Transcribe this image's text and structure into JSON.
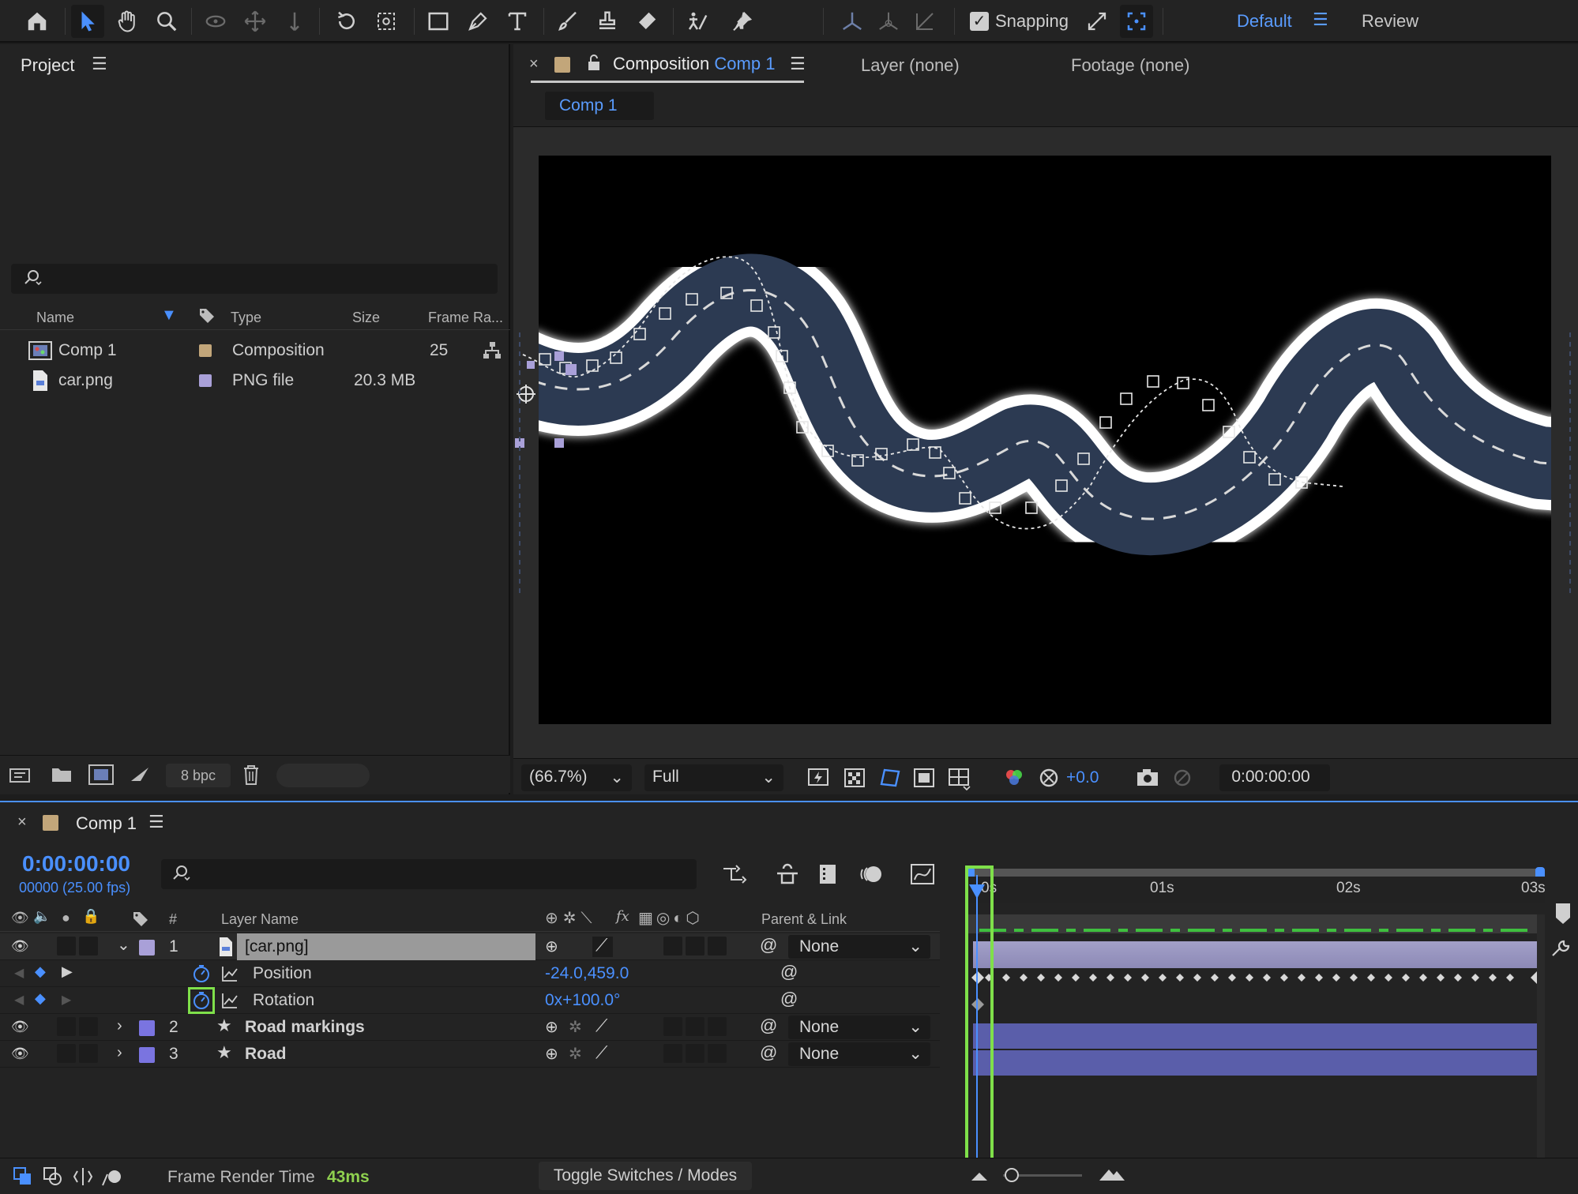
{
  "toolbar": {
    "snapping_label": "Snapping",
    "workspace_default": "Default",
    "workspace_review": "Review"
  },
  "project": {
    "title": "Project",
    "columns": {
      "name": "Name",
      "type": "Type",
      "size": "Size",
      "frame_rate": "Frame Ra..."
    },
    "items": [
      {
        "name": "Comp 1",
        "type": "Composition",
        "size": "",
        "frame_rate": "25",
        "swatch": "#c2a67a"
      },
      {
        "name": "car.png",
        "type": "PNG file",
        "size": "20.3 MB",
        "frame_rate": "",
        "swatch": "#a9a0d8"
      }
    ],
    "bpc_label": "8 bpc"
  },
  "composition": {
    "tab_prefix": "Composition",
    "tab_comp_name": "Comp 1",
    "layer_tab": "Layer (none)",
    "footage_tab": "Footage (none)",
    "subtab": "Comp 1",
    "zoom": "(66.7%)",
    "resolution": "Full",
    "exposure": "+0.0",
    "timecode": "0:00:00:00"
  },
  "timeline": {
    "tab_title": "Comp 1",
    "timecode": "0:00:00:00",
    "fps_line": "00000 (25.00 fps)",
    "header": {
      "hash": "#",
      "layer_name": "Layer Name",
      "parent_link": "Parent & Link"
    },
    "layers": [
      {
        "num": "1",
        "name": "[car.png]",
        "parent": "None",
        "color": "#a9a0d8"
      },
      {
        "num": "2",
        "name": "Road markings",
        "parent": "None",
        "color": "#7a74e0"
      },
      {
        "num": "3",
        "name": "Road",
        "parent": "None",
        "color": "#7a74e0"
      }
    ],
    "properties": [
      {
        "name": "Position",
        "value": "-24.0,459.0"
      },
      {
        "name": "Rotation",
        "value": "0x+100.0°"
      }
    ],
    "ruler": [
      "0s",
      "01s",
      "02s",
      "03s"
    ],
    "frame_render_time_label": "Frame Render Time",
    "frame_render_time_value": "43ms",
    "toggle_label": "Toggle Switches / Modes"
  },
  "colors": {
    "accent": "#4a90ff",
    "highlight": "#7fe04a",
    "road": "#2c3a52"
  }
}
